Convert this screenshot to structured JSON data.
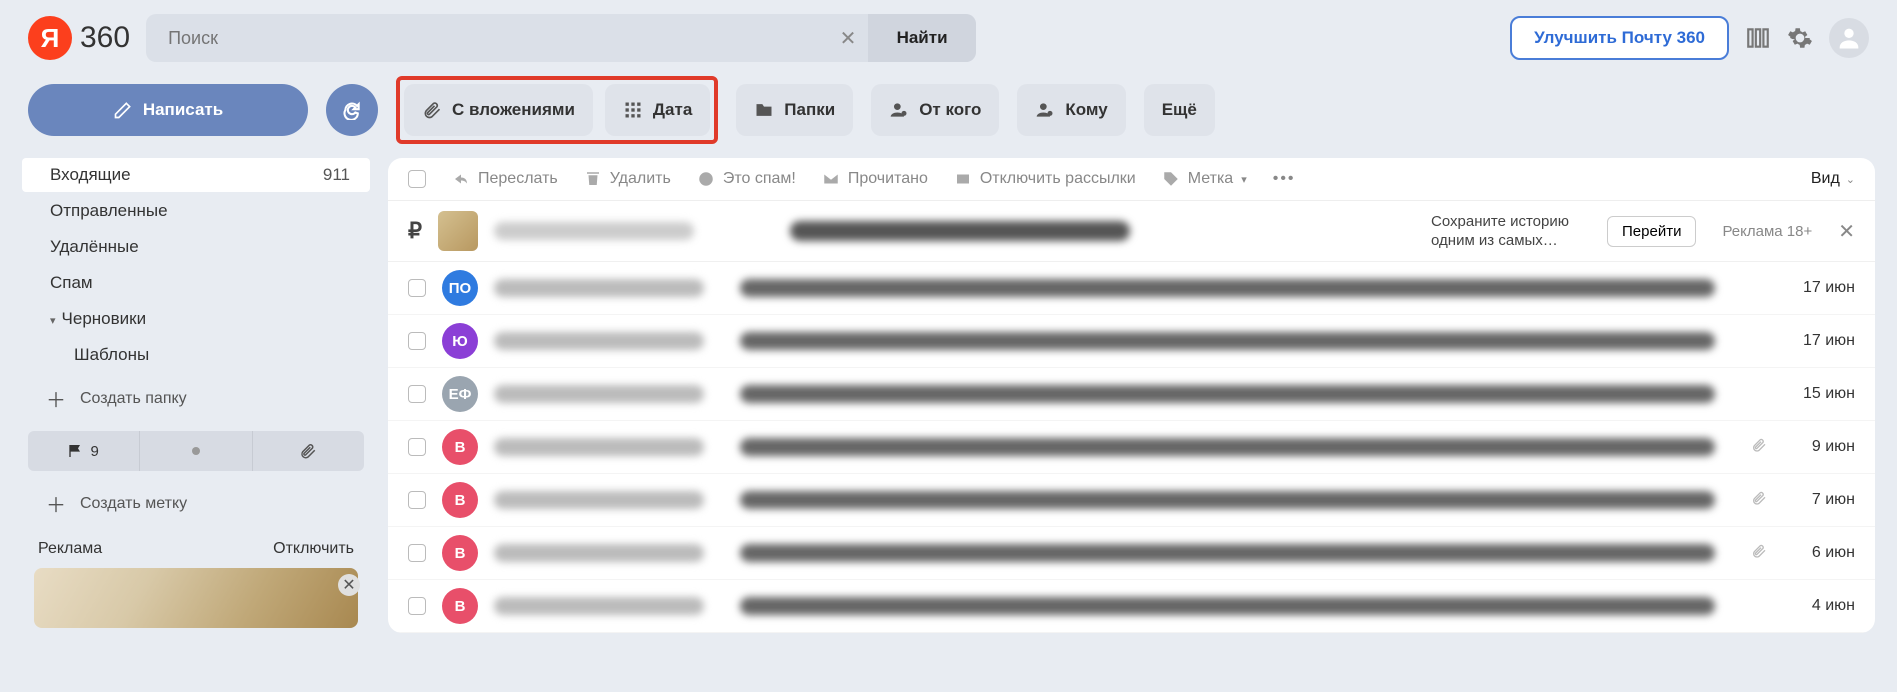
{
  "header": {
    "logo_letter": "Я",
    "logo_text": "360",
    "search_placeholder": "Поиск",
    "search_button": "Найти",
    "upgrade": "Улучшить Почту 360"
  },
  "compose": {
    "label": "Написать"
  },
  "chips": {
    "attachments": "С вложениями",
    "date": "Дата",
    "folders": "Папки",
    "from": "От кого",
    "to": "Кому",
    "more": "Ещё"
  },
  "folders": {
    "inbox": {
      "label": "Входящие",
      "count": "911"
    },
    "sent": {
      "label": "Отправленные"
    },
    "deleted": {
      "label": "Удалённые"
    },
    "spam": {
      "label": "Спам"
    },
    "drafts": {
      "label": "Черновики"
    },
    "templates": {
      "label": "Шаблоны"
    },
    "create_folder": "Создать папку",
    "create_label": "Создать метку"
  },
  "tab3_count": "9",
  "ad": {
    "label": "Реклама",
    "disable": "Отключить"
  },
  "ml_actions": {
    "forward": "Переслать",
    "delete": "Удалить",
    "spam": "Это спам!",
    "read": "Прочитано",
    "unsubscribe": "Отключить рассылки",
    "label": "Метка",
    "view": "Вид"
  },
  "promo": {
    "save_text": "Сохраните историю одним из самых…",
    "goto": "Перейти",
    "ad_label": "Реклама 18+"
  },
  "messages": [
    {
      "avatar_text": "ПО",
      "avatar_color": "#2f7be0",
      "date": "17 июн",
      "clip": false
    },
    {
      "avatar_text": "Ю",
      "avatar_color": "#8b3fd6",
      "date": "17 июн",
      "clip": false
    },
    {
      "avatar_text": "ЕФ",
      "avatar_color": "#9aa5b0",
      "date": "15 июн",
      "clip": false
    },
    {
      "avatar_text": "В",
      "avatar_color": "#e84f6a",
      "date": "9 июн",
      "clip": true
    },
    {
      "avatar_text": "В",
      "avatar_color": "#e84f6a",
      "date": "7 июн",
      "clip": true
    },
    {
      "avatar_text": "В",
      "avatar_color": "#e84f6a",
      "date": "6 июн",
      "clip": true
    },
    {
      "avatar_text": "В",
      "avatar_color": "#e84f6a",
      "date": "4 июн",
      "clip": false
    }
  ]
}
